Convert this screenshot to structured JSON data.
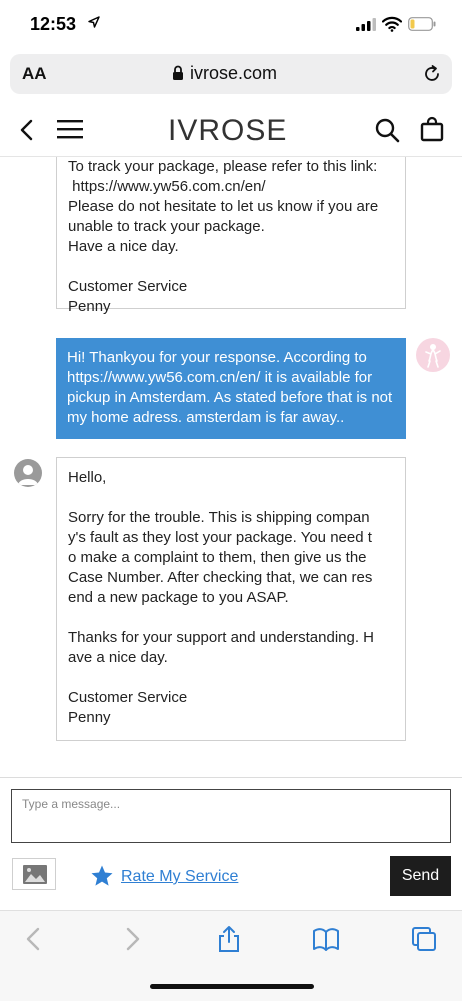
{
  "status_bar": {
    "time": "12:53",
    "icons": [
      "location-arrow-icon",
      "signal-bars-icon",
      "wifi-icon",
      "battery-icon"
    ]
  },
  "browser": {
    "text_size_label": "AA",
    "url": "ivrose.com"
  },
  "site": {
    "brand": "IVROSE",
    "icons": [
      "back-icon",
      "menu-icon",
      "search-icon",
      "shopping-bag-icon"
    ]
  },
  "messages": [
    {
      "sender": "support",
      "text": "To track your package, please refer to this link:\n https://www.yw56.com.cn/en/\nPlease do not hesitate to let us know if you are unable to track your package.\nHave a nice day.\n\nCustomer Service\nPenny"
    },
    {
      "sender": "user",
      "text": "Hi! Thankyou for your response. According to https://www.yw56.com.cn/en/ it is available for pickup in Amsterdam. As stated before that is not my home adress. amsterdam is far away.."
    },
    {
      "sender": "support",
      "text": "Hello,\n\nSorry for the trouble. This is shipping compan\ny's fault as they lost your package. You need t\no make a complaint to them, then give us the Case Number. After checking that, we can res\nend a new package to you ASAP.\n\nThanks for your support and understanding. H\nave a nice day.\n\nCustomer Service\nPenny"
    }
  ],
  "composer": {
    "placeholder": "Type a message...",
    "rate_label": "Rate My Service",
    "send_label": "Send"
  },
  "colors": {
    "user_bubble": "#3f8fd4",
    "send_button": "#1d1d1d",
    "link": "#2f7fd3"
  }
}
